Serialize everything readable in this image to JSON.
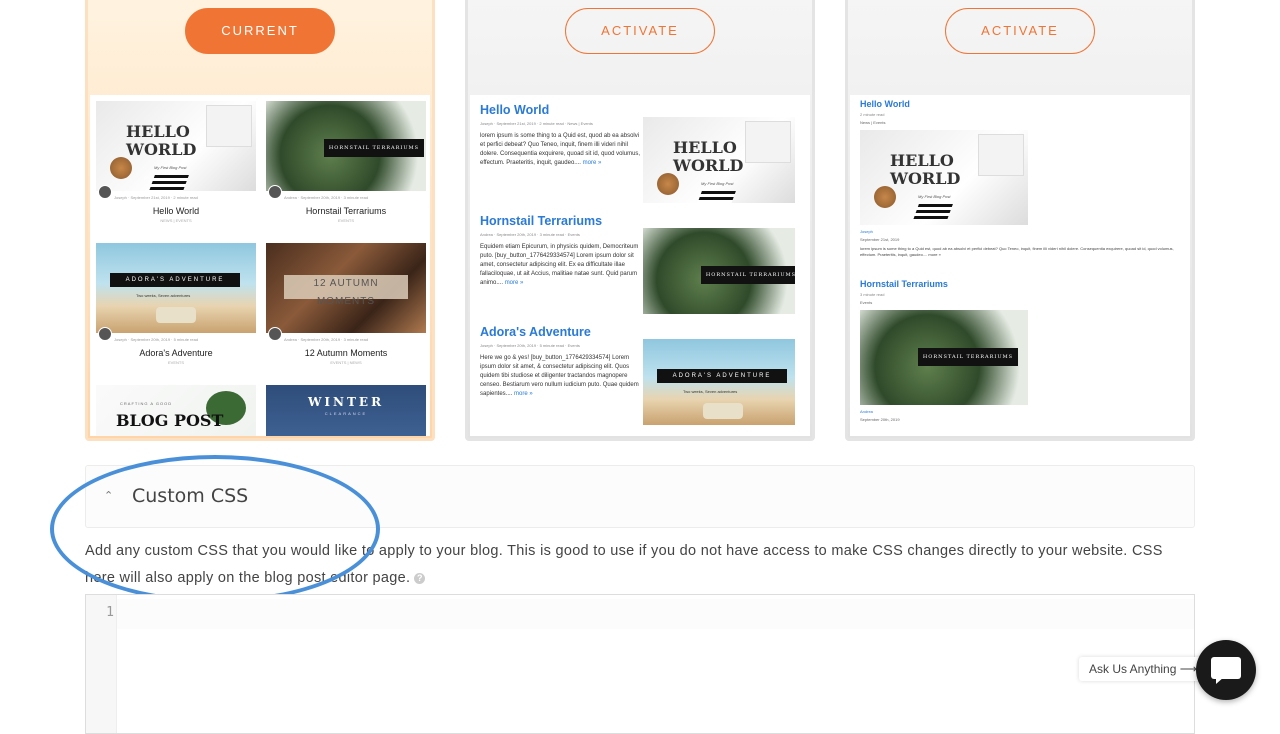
{
  "themes": {
    "current_label": "CURRENT",
    "activate_label": "ACTIVATE"
  },
  "grid_preview": {
    "posts": [
      {
        "title": "Hello World",
        "meta": "Joseph · September 21st, 2019 · 2 minute read",
        "category": "NEWS | EVENTS",
        "image_text": "HELLO WORLD",
        "image_sub": "My First Blog Post"
      },
      {
        "title": "Hornstail Terrariums",
        "meta": "Andrea · September 20th, 2019 · 3 minute read",
        "category": "EVENTS",
        "image_text": "HORNSTAIL TERRARIUMS"
      },
      {
        "title": "Adora's Adventure",
        "meta": "Joseph · September 20th, 2019 · 5 minute read",
        "category": "EVENTS",
        "image_text": "ADORA'S ADVENTURE",
        "image_sub": "Two weeks, Seven adventures"
      },
      {
        "title": "12 Autumn Moments",
        "meta": "Andrea · September 20th, 2019 · 3 minute read",
        "category": "EVENTS | NEWS",
        "image_text": "12 AUTUMN MOMENTS"
      },
      {
        "title": "",
        "meta": "",
        "category": "",
        "image_text": "BLOG POST",
        "image_sub": "CRAFTING A GOOD"
      },
      {
        "title": "",
        "meta": "",
        "category": "",
        "image_text": "WINTER",
        "image_sub": "CLEARANCE"
      }
    ]
  },
  "list_preview": {
    "posts": [
      {
        "title": "Hello World",
        "meta": "Joseph · September 21st, 2019 · 2 minute read · News | Events",
        "excerpt": "lorem ipsum is some thing to a Quid est, quod ab ea absolvi et perfici debeat? Quo Teneo, inquit, finem illi videri nihil dolere. Consequentia exquirere, quoad sit id, quod volumus, effectum. Praeteritis, inquit, gaudeo....",
        "more": "more »"
      },
      {
        "title": "Hornstail Terrariums",
        "meta": "Andrea · September 20th, 2019 · 3 minute read · Events",
        "excerpt": "Equidem etiam Epicurum, in physicis quidem, Democriteum puto. [buy_button_1776429334574] Lorem ipsum dolor sit amet, consectetur adipiscing elit. Ex ea difficultate illae fallaciloquae, ut ait Accius, malitiae natae sunt. Quid parum animo....",
        "more": "more »"
      },
      {
        "title": "Adora's Adventure",
        "meta": "Joseph · September 20th, 2019 · 5 minute read · Events",
        "excerpt": "Here we go & yes! [buy_button_1776429334574] Lorem ipsum dolor sit amet, & consectetur adipiscing elit. Quos quidem tibi studiose et diligenter tractandos magnopere censeo. Bestiarum vero nullum iudicium puto. Quae quidem sapientes....",
        "more": "more »"
      }
    ]
  },
  "single_preview": {
    "post1": {
      "title": "Hello World",
      "read": "2 minute read",
      "cats": "News | Events",
      "author": "Joseph",
      "date": "September 21st, 2019",
      "excerpt": "lorem ipsum is some thing to a Quid est, quod ab ea absolvi et perfici debeat? Quo Teneo, inquit, finem illi videri nihil dolere. Consequentia exquirere, quoad sit id, quod volumus, effectum. Praeteritis, inquit, gaudeo.... more »"
    },
    "post2": {
      "title": "Hornstail Terrariums",
      "read": "3 minute read",
      "cats": "Events",
      "author": "Andrea",
      "date": "September 20th, 2019"
    }
  },
  "custom_css": {
    "title": "Custom CSS",
    "description": "Add any custom CSS that you would like to apply to your blog. This is good to use if you do not have access to make CSS changes directly to your website. CSS here will also apply on the blog post editor page.",
    "line_number": "1",
    "code": ""
  },
  "support": {
    "ask_label": "Ask Us Anything ⟶"
  },
  "colors": {
    "accent": "#f07535",
    "link": "#2a7ad6",
    "highlight_ring": "#4a90d9"
  }
}
